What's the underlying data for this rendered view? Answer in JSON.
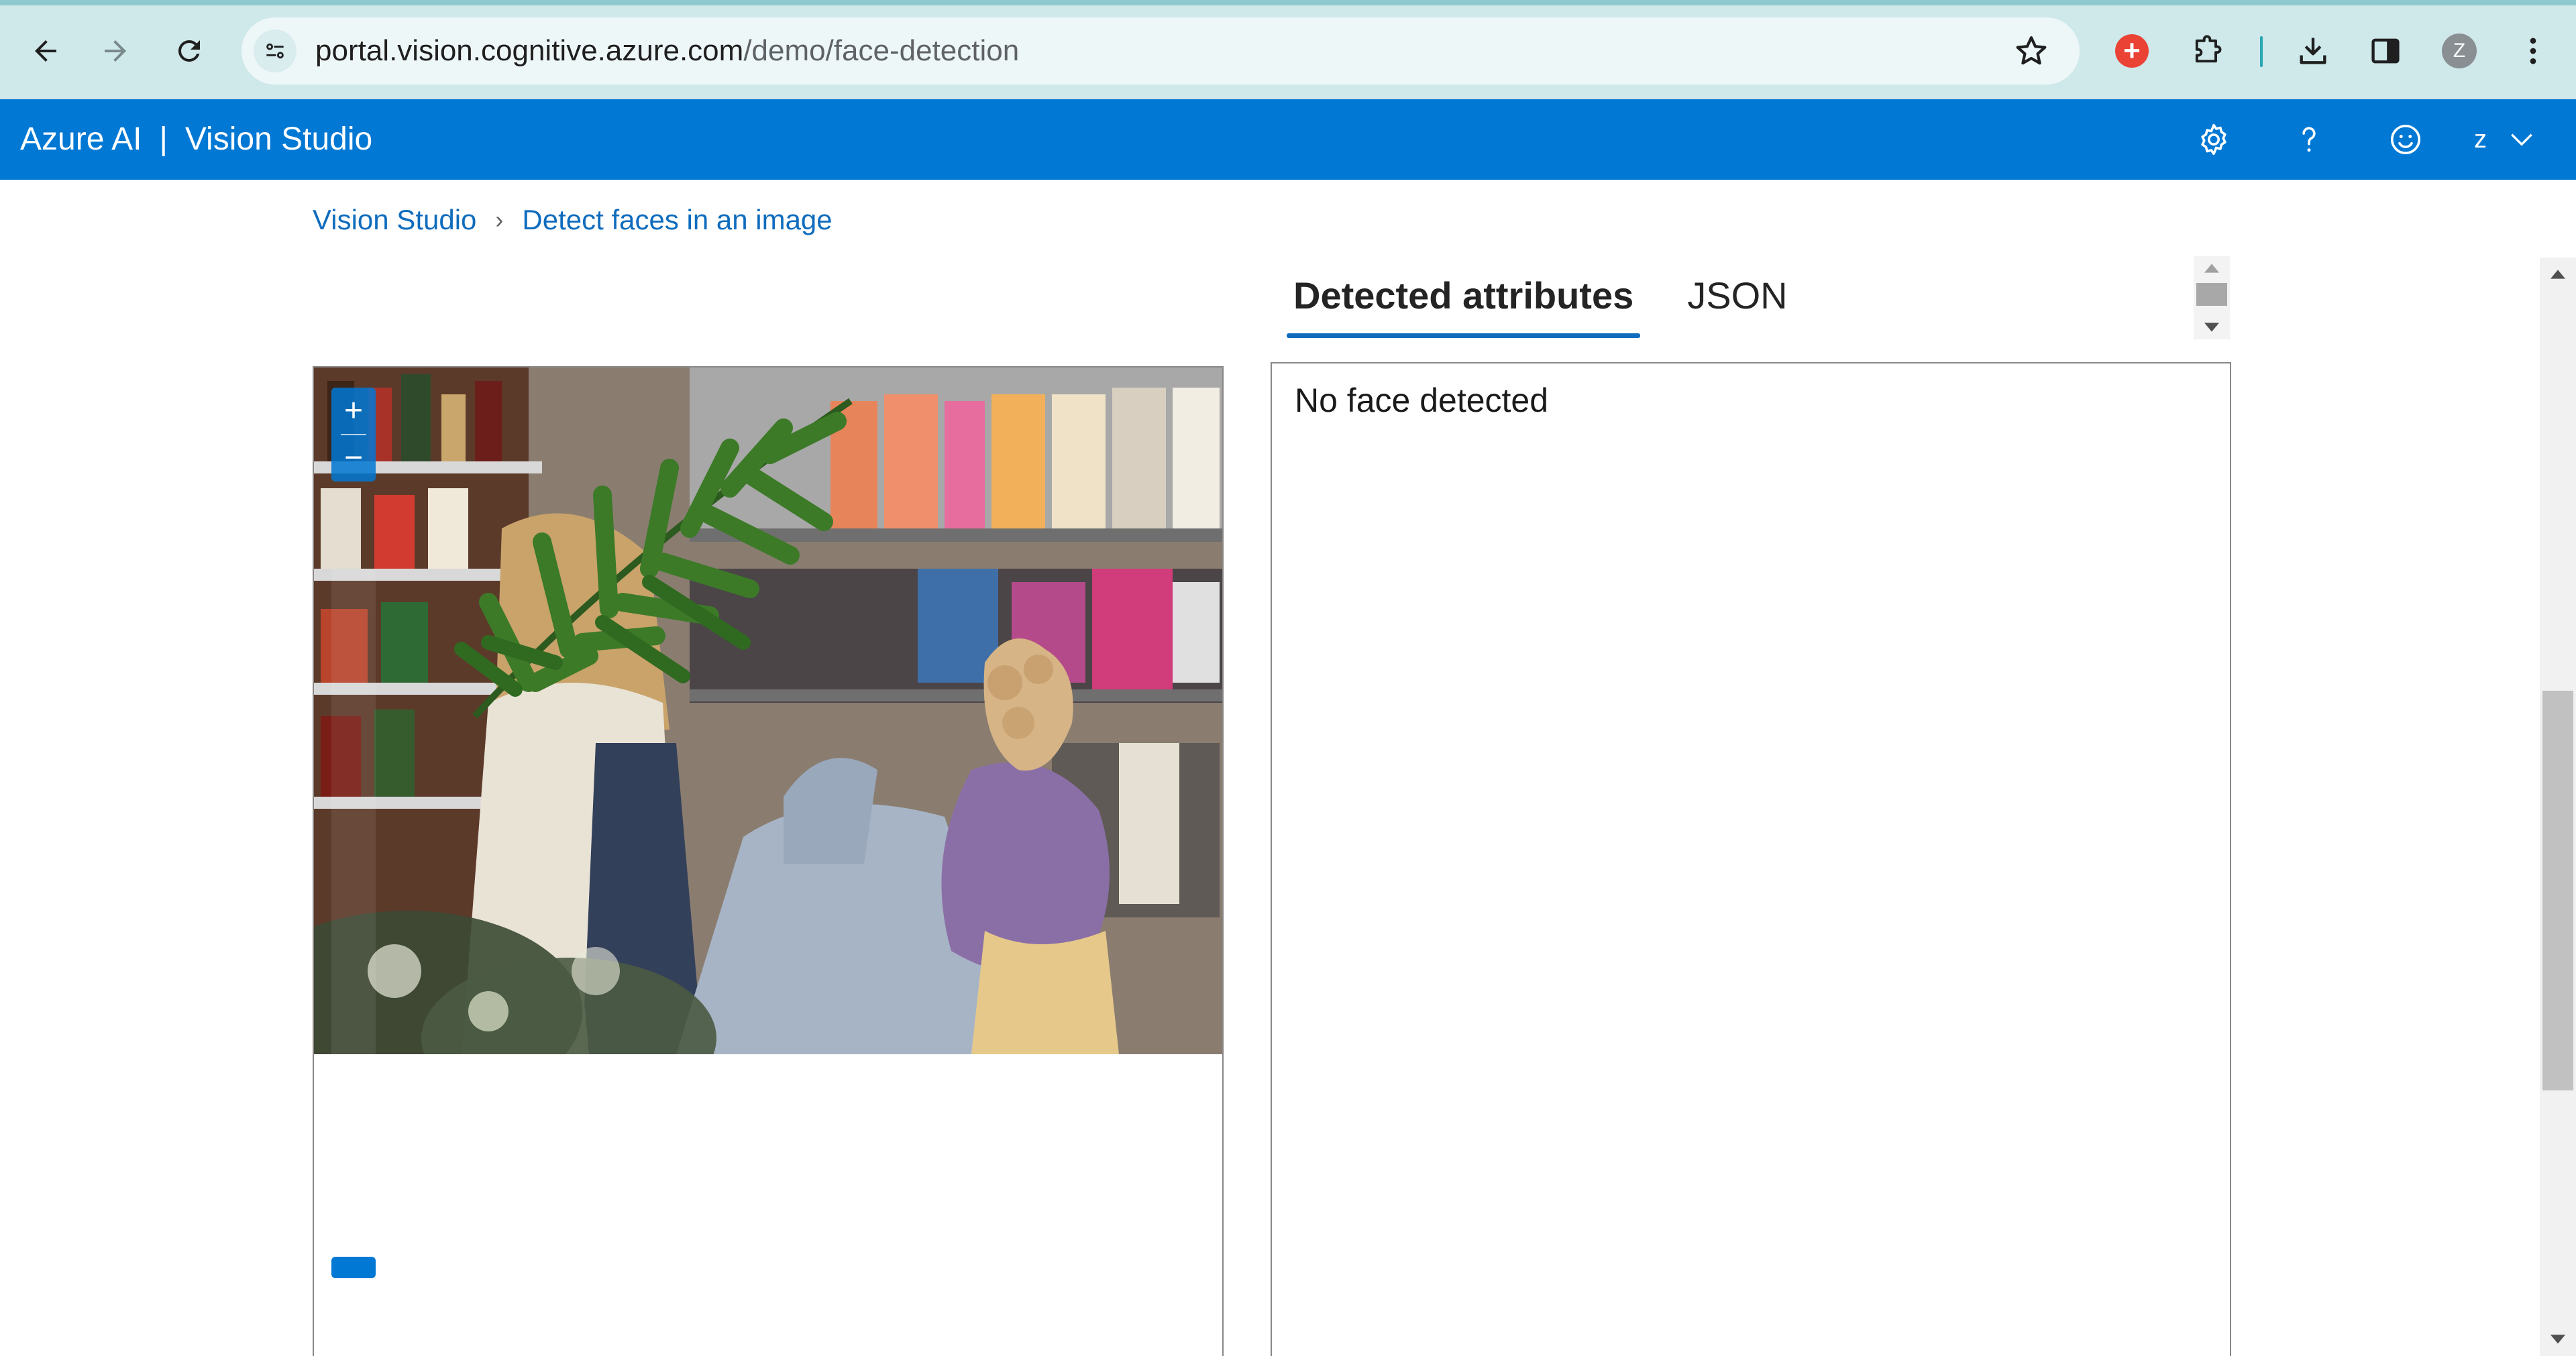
{
  "browser": {
    "url_host": "portal.vision.cognitive.azure.com",
    "url_path": "/demo/face-detection",
    "profile_initial": "Z",
    "extension_badge": "+",
    "icons": [
      "back-arrow-icon",
      "forward-arrow-icon",
      "reload-icon",
      "site-info-icon",
      "bookmark-star-icon",
      "extension-icon",
      "puzzle-extensions-icon",
      "downloads-icon",
      "side-panel-icon",
      "kebab-menu-icon"
    ]
  },
  "header": {
    "brand": "Azure AI",
    "separator": "|",
    "product": "Vision Studio",
    "user_initial": "z",
    "icons": [
      "settings-gear-icon",
      "help-question-icon",
      "feedback-smiley-icon",
      "chevron-down-icon"
    ],
    "background_color": "#0078d4"
  },
  "breadcrumb": {
    "items": [
      "Vision Studio",
      "Detect faces in an image"
    ]
  },
  "image_viewer": {
    "zoom_in_label": "+",
    "zoom_out_label": "−"
  },
  "results": {
    "tabs": [
      "Detected attributes",
      "JSON"
    ],
    "active_tab": "Detected attributes",
    "message": "No face detected"
  },
  "colors": {
    "accent": "#0f6cbd",
    "chrome_background": "#cfe8ea"
  }
}
